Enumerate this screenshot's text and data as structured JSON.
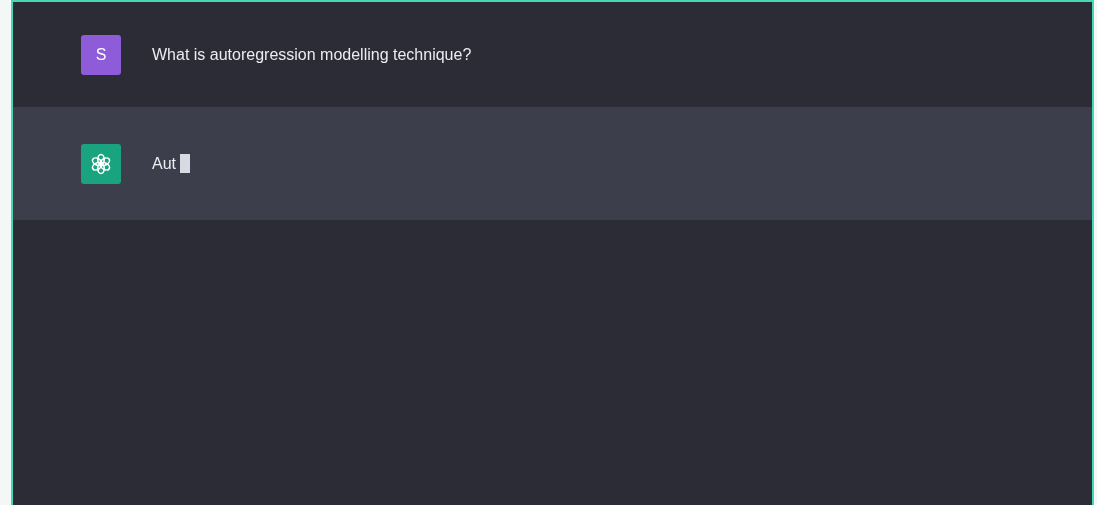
{
  "messages": [
    {
      "kind": "user",
      "avatar": "S",
      "text": "What is autoregression modelling technique?",
      "streaming": false
    },
    {
      "kind": "assistant",
      "text": "Aut",
      "streaming": true
    }
  ]
}
